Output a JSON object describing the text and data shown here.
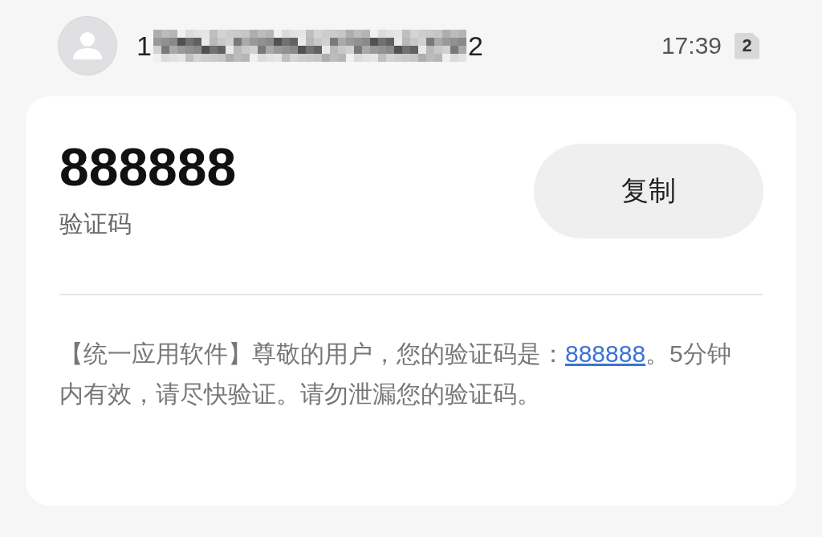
{
  "sender": {
    "start": "1",
    "end": "2"
  },
  "time": "17:39",
  "sim_badge": "2",
  "code": "888888",
  "code_label": "验证码",
  "copy_button": "复制",
  "message": {
    "before": "【统一应用软件】尊敬的用户，您的验证码是：",
    "link": "888888",
    "after": "。5分钟内有效，请尽快验证。请勿泄漏您的验证码。"
  }
}
